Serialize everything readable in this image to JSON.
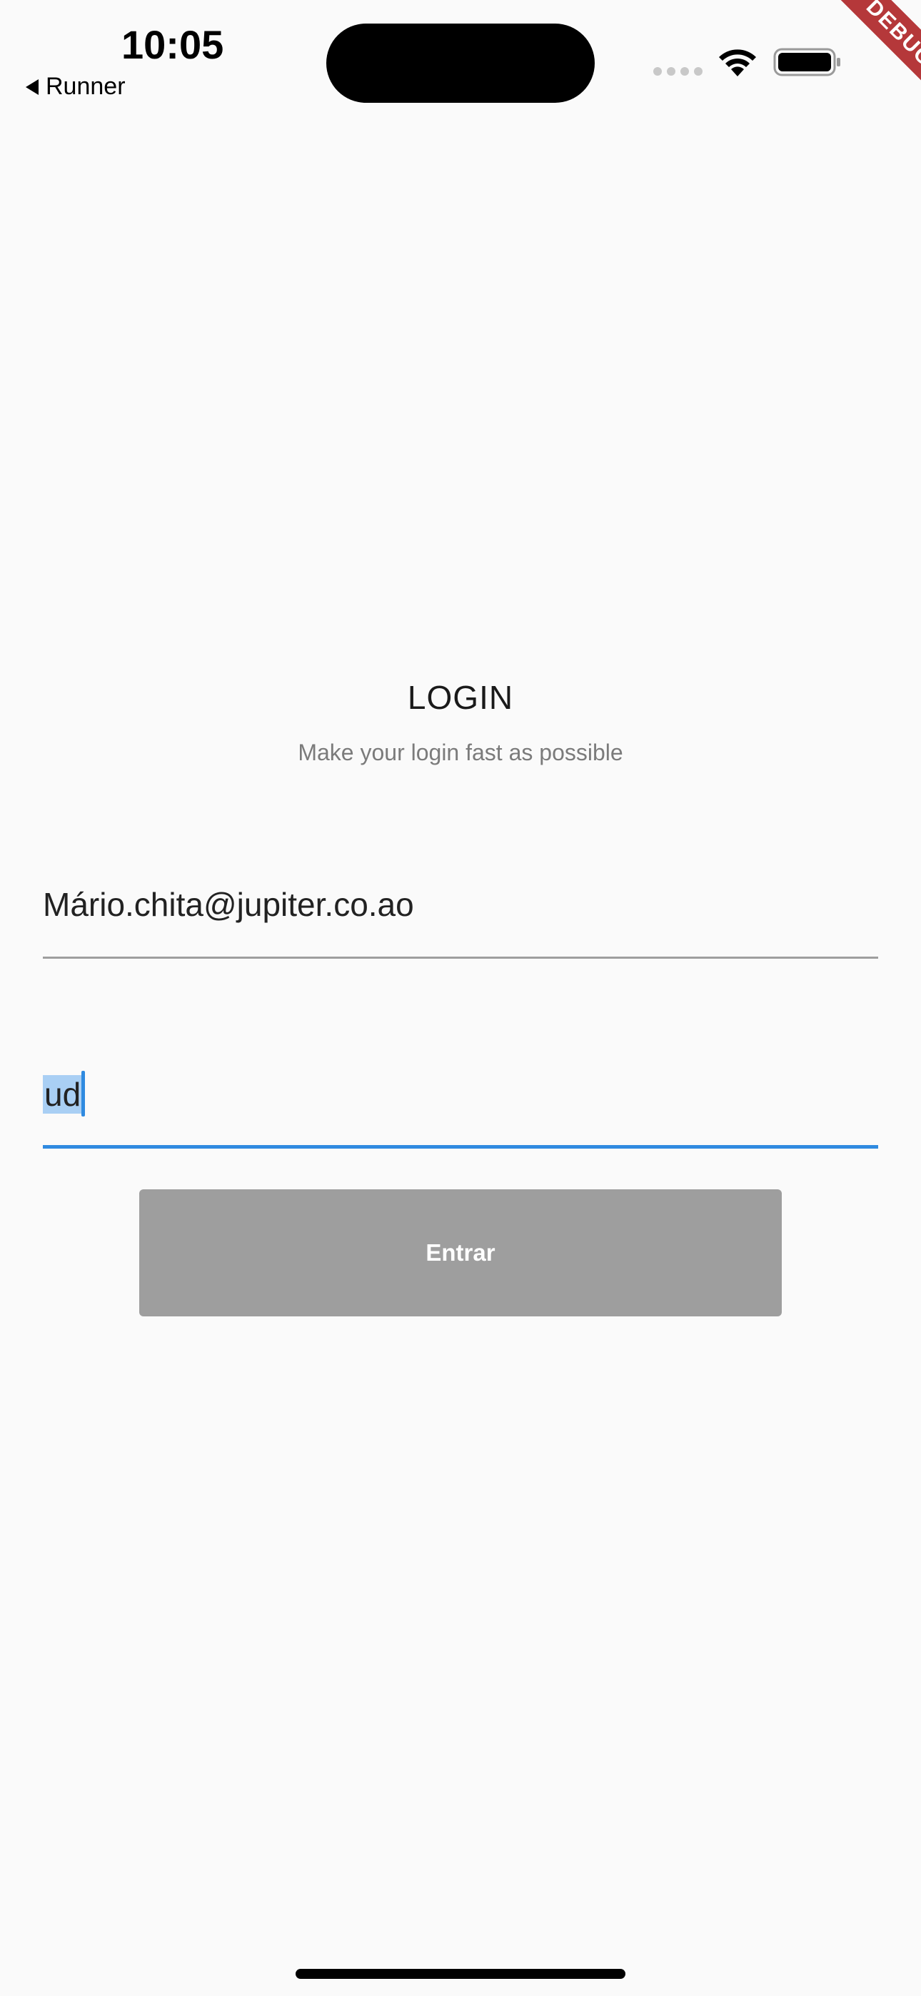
{
  "status_bar": {
    "time": "10:05",
    "back_app_label": "Runner",
    "icons": [
      "signal-dots-icon",
      "wifi-icon",
      "battery-icon"
    ]
  },
  "debug_banner": {
    "label": "DEBUG",
    "color": "#b5383a"
  },
  "header": {
    "title": "LOGIN",
    "subtitle": "Make your login fast as possible"
  },
  "form": {
    "email_value": "Mário.chita@jupiter.co.ao",
    "password_value": "ud",
    "submit_label": "Entrar"
  },
  "colors": {
    "focus_accent": "#2f8ae0",
    "button_disabled": "#9e9e9e",
    "background": "#fafafa"
  }
}
